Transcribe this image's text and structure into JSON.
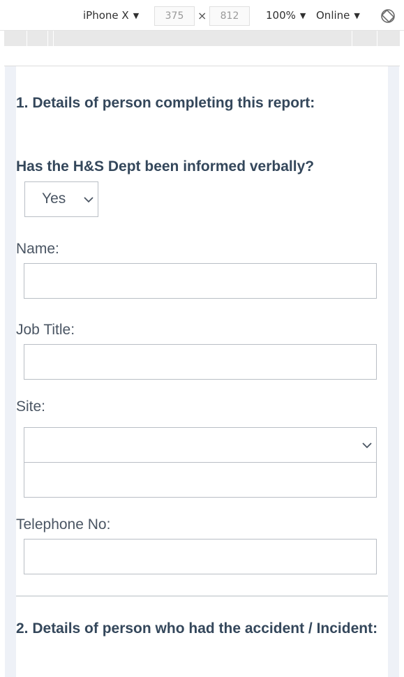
{
  "devtools": {
    "device": "iPhone X",
    "width": "375",
    "height": "812",
    "zoom": "100%",
    "network": "Online",
    "times_sign": "×"
  },
  "form": {
    "section1_title": "1. Details of person completing this report:",
    "hs_question": "Has the H&S Dept been informed verbally?",
    "hs_selected": "Yes",
    "name_label": "Name:",
    "name_value": "",
    "job_title_label": "Job Title:",
    "job_title_value": "",
    "site_label": "Site:",
    "site_selected": "",
    "site_other_value": "",
    "telephone_label": "Telephone No:",
    "telephone_value": "",
    "section2_title": "2. Details of person who had the accident / Incident:"
  },
  "colors": {
    "heading": "#34475b",
    "label": "#4a5563",
    "border": "#b9bec5",
    "side_panel": "#eef1f7"
  }
}
